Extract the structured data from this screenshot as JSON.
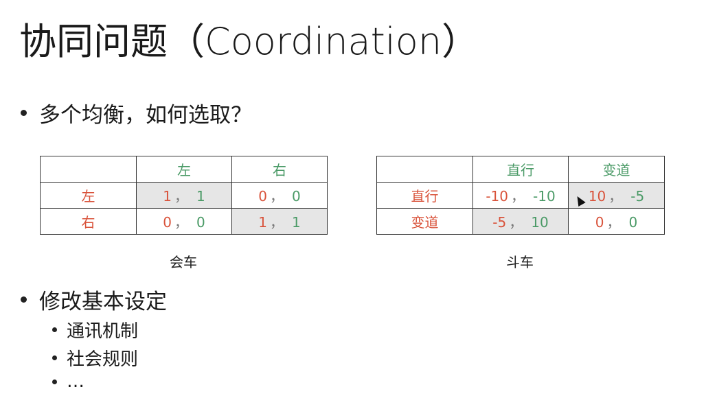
{
  "slide": {
    "title": "协同问题（Coordination）",
    "bullets": [
      "多个均衡，如何选取？",
      "修改基本设定"
    ],
    "sub_bullets": [
      "通讯机制",
      "社会规则",
      "…"
    ]
  },
  "table_left": {
    "caption": "会车",
    "col_headers": [
      "左",
      "右"
    ],
    "rows": [
      {
        "label": "左",
        "cells": [
          {
            "a": "1",
            "b": "1",
            "shaded": true
          },
          {
            "a": "0",
            "b": "0",
            "shaded": false
          }
        ]
      },
      {
        "label": "右",
        "cells": [
          {
            "a": "0",
            "b": "0",
            "shaded": false
          },
          {
            "a": "1",
            "b": "1",
            "shaded": true
          }
        ]
      }
    ]
  },
  "table_right": {
    "caption": "斗车",
    "col_headers": [
      "直行",
      "变道"
    ],
    "rows": [
      {
        "label": "直行",
        "cells": [
          {
            "a": "-10",
            "b": "-10",
            "shaded": false
          },
          {
            "a": "10",
            "b": "-5",
            "shaded": true
          }
        ]
      },
      {
        "label": "变道",
        "cells": [
          {
            "a": "-5",
            "b": "10",
            "shaded": true
          },
          {
            "a": "0",
            "b": "0",
            "shaded": false
          }
        ]
      }
    ]
  },
  "separator": "，",
  "colors": {
    "row_player": "#d9533b",
    "col_player": "#4a9a66",
    "equilibrium_shade": "#e6e6e6"
  }
}
